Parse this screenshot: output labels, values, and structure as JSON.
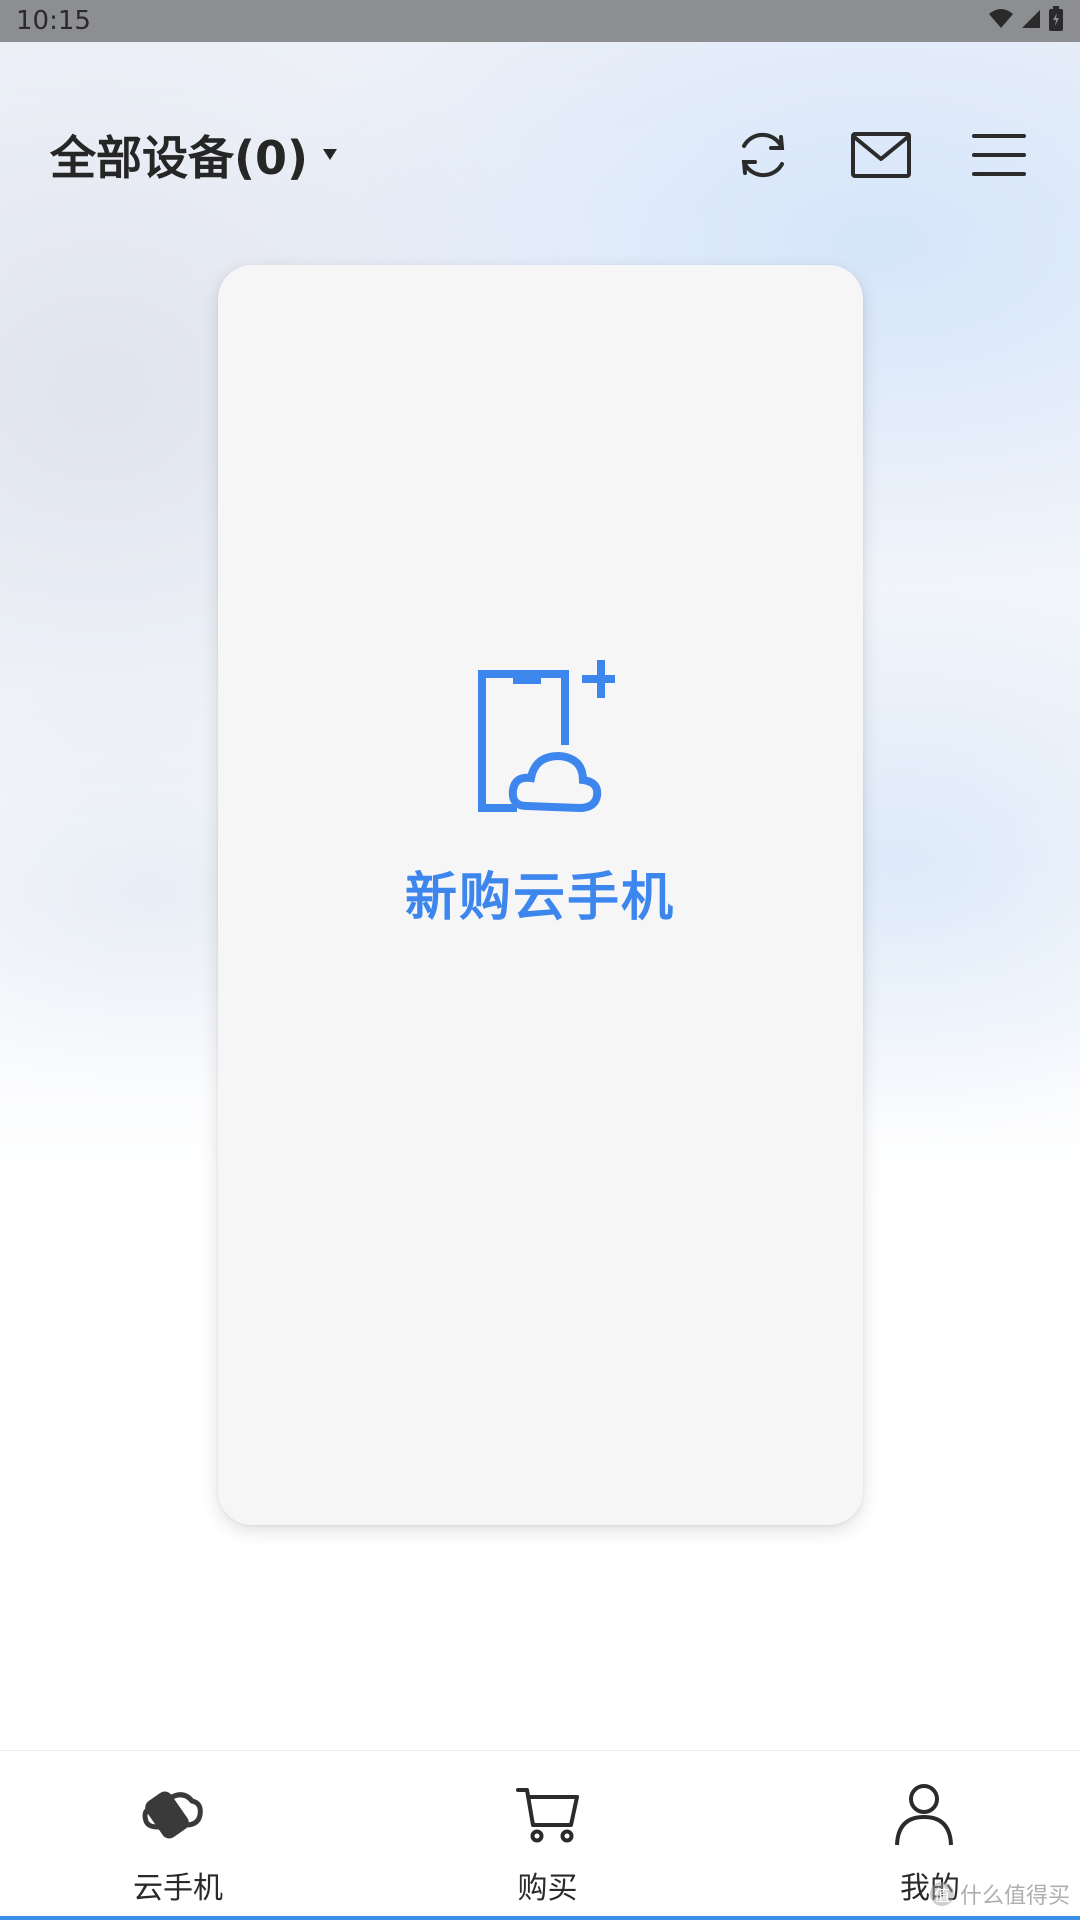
{
  "status_bar": {
    "time": "10:15",
    "icons": [
      "wifi-icon",
      "signal-icon",
      "battery-icon"
    ]
  },
  "header": {
    "device_selector_label": "全部设备(0)",
    "actions": [
      "refresh-icon",
      "mail-icon",
      "menu-icon"
    ]
  },
  "card": {
    "label": "新购云手机",
    "icon": "add-cloud-phone-icon",
    "accent_color": "#3d86ee"
  },
  "bottom_nav": {
    "items": [
      {
        "label": "云手机",
        "icon": "cloud-phone-icon"
      },
      {
        "label": "购买",
        "icon": "cart-icon"
      },
      {
        "label": "我的",
        "icon": "user-icon"
      }
    ]
  },
  "watermark": {
    "badge": "值",
    "text": "什么值得买"
  }
}
